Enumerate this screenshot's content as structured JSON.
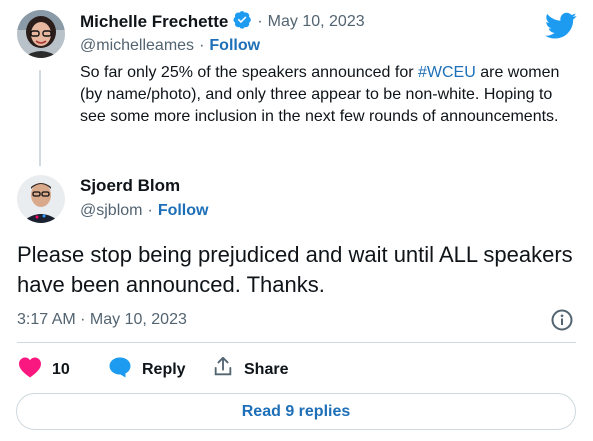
{
  "parent_tweet": {
    "author_name": "Michelle Frechette",
    "date_prefix": "·",
    "date": "May 10, 2023",
    "handle": "@michelleames",
    "separator": "·",
    "follow_label": "Follow",
    "text_before_hashtag": "So far only 25% of the speakers announced for ",
    "hashtag": "#WCEU",
    "text_after_hashtag": " are women (by name/photo), and only three appear to be non-white. Hoping to see some more inclusion in the next few rounds of announcements."
  },
  "reply_tweet": {
    "author_name": "Sjoerd Blom",
    "handle": "@sjblom",
    "separator": "·",
    "follow_label": "Follow",
    "text": "Please stop being prejudiced and wait until ALL speakers have been announced. Thanks.",
    "timestamp": "3:17 AM · May 10, 2023"
  },
  "actions": {
    "like_count": "10",
    "reply_label": "Reply",
    "share_label": "Share"
  },
  "read_replies_label": "Read 9 replies",
  "colors": {
    "brand_blue": "#1d9bf0",
    "link_blue": "#1d6fb8",
    "like_pink": "#f91880",
    "muted": "#536471",
    "border": "#cfd9de"
  },
  "icons": [
    "twitter-bird-icon",
    "verified-badge-icon",
    "info-icon",
    "heart-icon",
    "reply-bubble-icon",
    "share-icon"
  ]
}
